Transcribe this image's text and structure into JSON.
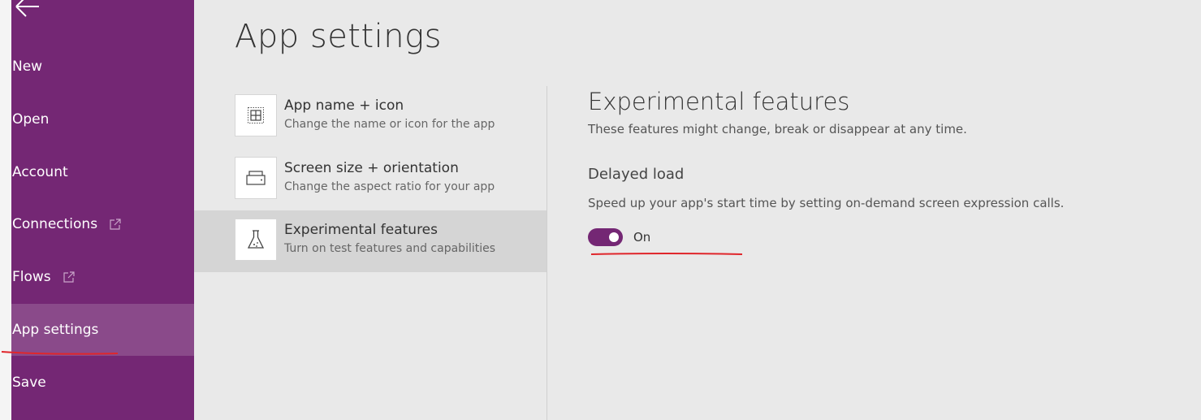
{
  "sidebar": {
    "items": [
      {
        "label": "New"
      },
      {
        "label": "Open"
      },
      {
        "label": "Account"
      },
      {
        "label": "Connections"
      },
      {
        "label": "Flows"
      },
      {
        "label": "App settings"
      },
      {
        "label": "Save"
      }
    ]
  },
  "main": {
    "title": "App settings",
    "settings": [
      {
        "title": "App name + icon",
        "subtitle": "Change the name or icon for the app",
        "icon": "app-icon-grid-icon"
      },
      {
        "title": "Screen size + orientation",
        "subtitle": "Change the aspect ratio for your app",
        "icon": "screen-size-icon"
      },
      {
        "title": "Experimental features",
        "subtitle": "Turn on test features and capabilities",
        "icon": "flask-icon"
      }
    ]
  },
  "panel": {
    "title": "Experimental features",
    "subtitle": "These features might change, break or disappear at any time.",
    "option": {
      "title": "Delayed load",
      "description": "Speed up your app's start time by setting on-demand screen expression calls.",
      "toggle_state": "On"
    }
  },
  "colors": {
    "brand": "#742774",
    "sidebar_active": "#8a4a8a",
    "annotation": "#e0262b"
  }
}
